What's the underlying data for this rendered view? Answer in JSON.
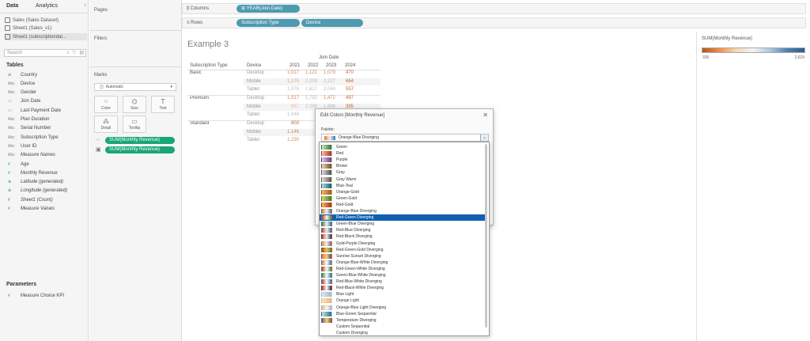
{
  "left_pane": {
    "tabs": [
      "Data",
      "Analytics"
    ],
    "collapse_glyph": "‹",
    "datasources": [
      "Sales (Sales Dataset)",
      "Sheet1 (Sales_v1)",
      "Sheet1 (subscriptiondat..."
    ],
    "search_placeholder": "Search",
    "tables_title": "Tables",
    "fields": [
      {
        "icon": "⊕",
        "name": "Country",
        "kind": "gray"
      },
      {
        "icon": "Abc",
        "name": "Device",
        "kind": "gray"
      },
      {
        "icon": "Abc",
        "name": "Gender",
        "kind": "gray"
      },
      {
        "icon": "▭",
        "name": "Join Date",
        "kind": "gray"
      },
      {
        "icon": "▭",
        "name": "Last Payment Date",
        "kind": "gray"
      },
      {
        "icon": "Abc",
        "name": "Plan Duration",
        "kind": "gray"
      },
      {
        "icon": "Abc",
        "name": "Serial Number",
        "kind": "gray"
      },
      {
        "icon": "Abc",
        "name": "Subscription Type",
        "kind": "gray"
      },
      {
        "icon": "Abc",
        "name": "User ID",
        "kind": "gray"
      },
      {
        "icon": "Abc",
        "name": "Measure Names",
        "kind": "gray-italic"
      },
      {
        "icon": "#",
        "name": "Age",
        "kind": "green"
      },
      {
        "icon": "#",
        "name": "Monthly Revenue",
        "kind": "green"
      },
      {
        "icon": "⊕",
        "name": "Latitude (generated)",
        "kind": "green-italic"
      },
      {
        "icon": "⊕",
        "name": "Longitude (generated)",
        "kind": "green-italic"
      },
      {
        "icon": "#",
        "name": "Sheet1 (Count)",
        "kind": "green-italic"
      },
      {
        "icon": "#",
        "name": "Measure Values",
        "kind": "green-italic"
      }
    ],
    "parameters_title": "Parameters",
    "parameters": [
      {
        "icon": "#",
        "name": "Measure Choice KPI"
      }
    ]
  },
  "shelves": {
    "pages_title": "Pages",
    "filters_title": "Filters",
    "marks_title": "Marks",
    "marks_type": "Automatic",
    "mark_buttons": [
      {
        "label": "Color",
        "icon": "⁘"
      },
      {
        "label": "Size",
        "icon": "⌬"
      },
      {
        "label": "Text",
        "icon": "T"
      },
      {
        "label": "Detail",
        "icon": "⁂"
      },
      {
        "label": "Tooltip",
        "icon": "▭"
      }
    ],
    "mark_pills": [
      "SUM(Monthly Revenue)",
      "SUM(Monthly Revenue)"
    ],
    "columns_label": "Columns",
    "columns_pill": "YEAR(Join Date)",
    "rows_label": "Rows",
    "rows_pills": [
      "Subscription Type",
      "Device"
    ]
  },
  "viz": {
    "title": "Example 3",
    "col_header_main": "Join Date",
    "row_header_1": "Subscription Type",
    "row_header_2": "Device",
    "years": [
      "2021",
      "2022",
      "2023",
      "2024"
    ],
    "groups": [
      {
        "name": "Basic",
        "rows": [
          {
            "device": "Desktop",
            "values": [
              "1,017",
              "1,121",
              "1,079",
              "470"
            ]
          },
          {
            "device": "Mobile",
            "values": [
              "1,175",
              "2,209",
              "2,227",
              "664"
            ]
          },
          {
            "device": "Tablet",
            "values": [
              "1,076",
              "1,617",
              "2,044",
              "557"
            ]
          }
        ]
      },
      {
        "name": "Premium",
        "rows": [
          {
            "device": "Desktop",
            "values": [
              "1,017",
              "1,792",
              "1,472",
              "497"
            ]
          },
          {
            "device": "Mobile",
            "values": [
              "957",
              "2,295",
              "1,986",
              "395"
            ]
          },
          {
            "device": "Tablet",
            "values": [
              "1,046",
              "",
              "",
              ""
            ]
          }
        ]
      },
      {
        "name": "Standard",
        "rows": [
          {
            "device": "Desktop",
            "values": [
              "803",
              "",
              "",
              ""
            ]
          },
          {
            "device": "Mobile",
            "values": [
              "1,146",
              "",
              "",
              ""
            ]
          },
          {
            "device": "Tablet",
            "values": [
              "1,230",
              "",
              "",
              ""
            ]
          }
        ]
      }
    ],
    "colors": {
      "low": "#d9825b",
      "mid": "#e8b8a0",
      "high": "#b7bcc4",
      "text_dark": "#555555"
    }
  },
  "legend": {
    "title": "SUM(Monthly Revenue)",
    "min": "335",
    "max": "2,629"
  },
  "dialog": {
    "title": "Edit Colors [Monthly Revenue]",
    "close_glyph": "✕",
    "palette_label": "Palette:",
    "palette_value": "Orange-Blue Diverging",
    "dropdown_glyph": "⌄",
    "palette_options": [
      {
        "name": "Green",
        "colors": [
          "#cfe8c6",
          "#2c7a2c"
        ]
      },
      {
        "name": "Red",
        "colors": [
          "#f6c6b6",
          "#b22d1f"
        ]
      },
      {
        "name": "Purple",
        "colors": [
          "#e2cde6",
          "#6c3a83"
        ]
      },
      {
        "name": "Brown",
        "colors": [
          "#e8d5c2",
          "#7a4a22"
        ]
      },
      {
        "name": "Gray",
        "colors": [
          "#e0e0e0",
          "#4f4f4f"
        ]
      },
      {
        "name": "Gray Warm",
        "colors": [
          "#e6dfd9",
          "#5a524c"
        ]
      },
      {
        "name": "Blue-Teal",
        "colors": [
          "#bcd9ea",
          "#14606b"
        ]
      },
      {
        "name": "Orange-Gold",
        "colors": [
          "#f5b962",
          "#a65a12"
        ]
      },
      {
        "name": "Green-Gold",
        "colors": [
          "#e6d565",
          "#2d7a3a"
        ]
      },
      {
        "name": "Red-Gold",
        "colors": [
          "#f2c155",
          "#b12a1f"
        ]
      },
      {
        "name": "Orange-Blue Diverging",
        "colors": [
          "#e37d27",
          "#f2f2f2",
          "#3b6fa7"
        ]
      },
      {
        "name": "Red-Green Diverging",
        "colors": [
          "#c43a2e",
          "#f2f2f2",
          "#3e8b3e"
        ]
      },
      {
        "name": "Green-Blue Diverging",
        "colors": [
          "#3e8b3e",
          "#f2f2f2",
          "#3b6fa7"
        ]
      },
      {
        "name": "Red-Blue Diverging",
        "colors": [
          "#c43a2e",
          "#f2f2f2",
          "#3b6fa7"
        ]
      },
      {
        "name": "Red-Black Diverging",
        "colors": [
          "#c43a2e",
          "#f2f2f2",
          "#333333"
        ]
      },
      {
        "name": "Gold-Purple Diverging",
        "colors": [
          "#d4a23a",
          "#f2f2f2",
          "#7b4c9a"
        ]
      },
      {
        "name": "Red-Green-Gold Diverging",
        "colors": [
          "#c43a2e",
          "#e8c75a",
          "#3e8b3e"
        ]
      },
      {
        "name": "Sunrise-Sunset Diverging",
        "colors": [
          "#e7773f",
          "#f5d66b",
          "#5a3a8a"
        ]
      },
      {
        "name": "Orange-Blue-White Diverging",
        "colors": [
          "#e37d27",
          "#ffffff",
          "#3b6fa7"
        ]
      },
      {
        "name": "Red-Green-White Diverging",
        "colors": [
          "#c43a2e",
          "#ffffff",
          "#3e8b3e"
        ]
      },
      {
        "name": "Green-Blue-White Diverging",
        "colors": [
          "#3e8b3e",
          "#ffffff",
          "#3b6fa7"
        ]
      },
      {
        "name": "Red-Blue-White Diverging",
        "colors": [
          "#c43a2e",
          "#ffffff",
          "#3b6fa7"
        ]
      },
      {
        "name": "Red-Black-White Diverging",
        "colors": [
          "#c43a2e",
          "#ffffff",
          "#333333"
        ]
      },
      {
        "name": "Blue Light",
        "colors": [
          "#dfe9f3",
          "#9fbcd8"
        ]
      },
      {
        "name": "Orange Light",
        "colors": [
          "#fbe3cc",
          "#f2b57a"
        ]
      },
      {
        "name": "Orange-Blue Light Diverging",
        "colors": [
          "#f2b57a",
          "#f7f7f7",
          "#9fbcd8"
        ]
      },
      {
        "name": "Blue-Green Sequential",
        "colors": [
          "#c9e7d9",
          "#2d6fa0"
        ]
      },
      {
        "name": "Temperature Diverging",
        "colors": [
          "#3b6fa7",
          "#f5d66b",
          "#c43a2e"
        ]
      },
      {
        "name": "Custom Sequential",
        "colors": []
      },
      {
        "name": "Custom Diverging",
        "colors": []
      }
    ],
    "selected_option": "Red-Green Diverging"
  }
}
